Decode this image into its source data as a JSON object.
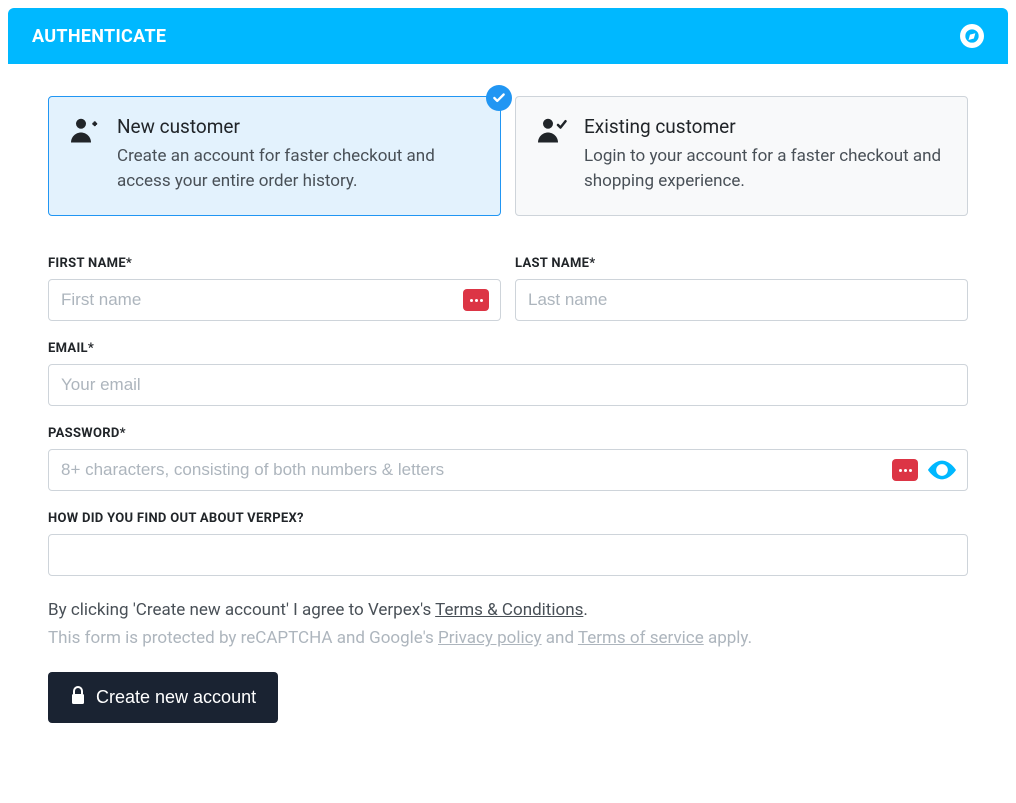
{
  "header": {
    "title": "AUTHENTICATE"
  },
  "choices": {
    "new": {
      "title": "New customer",
      "desc": "Create an account for faster checkout and access your entire order history."
    },
    "existing": {
      "title": "Existing customer",
      "desc": "Login to your account for a faster checkout and shopping experience."
    }
  },
  "form": {
    "first_name": {
      "label": "FIRST NAME*",
      "placeholder": "First name",
      "value": ""
    },
    "last_name": {
      "label": "LAST NAME*",
      "placeholder": "Last name",
      "value": ""
    },
    "email": {
      "label": "EMAIL*",
      "placeholder": "Your email",
      "value": ""
    },
    "password": {
      "label": "PASSWORD*",
      "placeholder": "8+ characters, consisting of both numbers & letters",
      "value": ""
    },
    "findout": {
      "label": "HOW DID YOU FIND OUT ABOUT VERPEX?",
      "value": ""
    }
  },
  "legal": {
    "terms_prefix": "By clicking 'Create new account' I agree to Verpex's ",
    "terms_link": "Terms & Conditions",
    "terms_suffix": ".",
    "recaptcha_prefix": "This form is protected by reCAPTCHA and Google's ",
    "privacy_link": "Privacy policy",
    "recaptcha_mid": " and ",
    "tos_link": "Terms of service",
    "recaptcha_suffix": " apply."
  },
  "submit": {
    "label": "Create new account"
  }
}
